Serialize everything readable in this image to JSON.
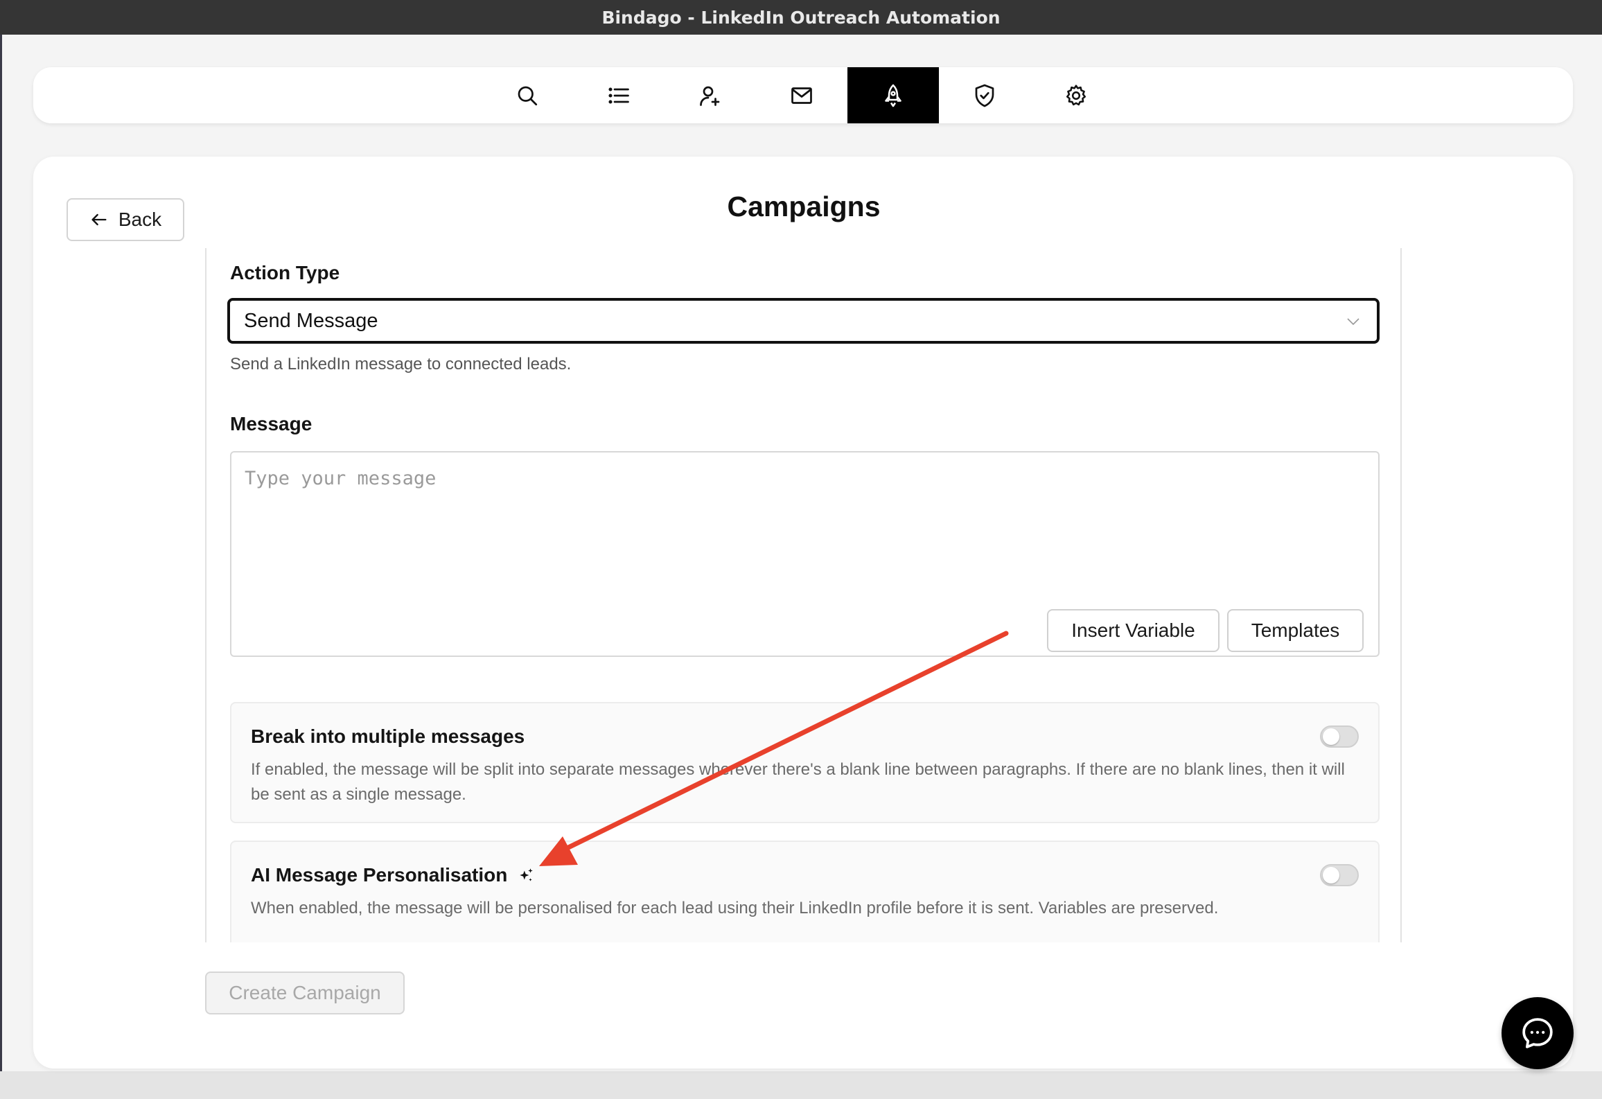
{
  "window": {
    "title": "Bindago - LinkedIn Outreach Automation"
  },
  "nav": {
    "items": [
      {
        "icon": "search-icon",
        "active": false
      },
      {
        "icon": "list-icon",
        "active": false
      },
      {
        "icon": "user-add-icon",
        "active": false
      },
      {
        "icon": "mail-icon",
        "active": false
      },
      {
        "icon": "rocket-icon",
        "active": true
      },
      {
        "icon": "shield-check-icon",
        "active": false
      },
      {
        "icon": "gear-icon",
        "active": false
      }
    ]
  },
  "header": {
    "back_label": "Back",
    "title": "Campaigns"
  },
  "form": {
    "action_type": {
      "label": "Action Type",
      "value": "Send Message",
      "help": "Send a LinkedIn message to connected leads."
    },
    "message": {
      "label": "Message",
      "placeholder": "Type your message",
      "insert_variable_label": "Insert Variable",
      "templates_label": "Templates"
    },
    "break_messages": {
      "title": "Break into multiple messages",
      "description": "If enabled, the message will be split into separate messages wherever there's a blank line between paragraphs. If there are no blank lines, then it will be sent as a single message.",
      "enabled": false
    },
    "ai_personalisation": {
      "title": "AI Message Personalisation",
      "icon": "sparkle-icon",
      "description": "When enabled, the message will be personalised for each lead using their LinkedIn profile before it is sent. Variables are preserved.",
      "enabled": false
    },
    "create_label": "Create Campaign"
  },
  "chat": {
    "icon": "chat-bubble-icon"
  },
  "annotation": {
    "arrow_color": "#e8412c"
  },
  "colors": {
    "active_nav": "#000000",
    "titlebar": "#353535"
  }
}
